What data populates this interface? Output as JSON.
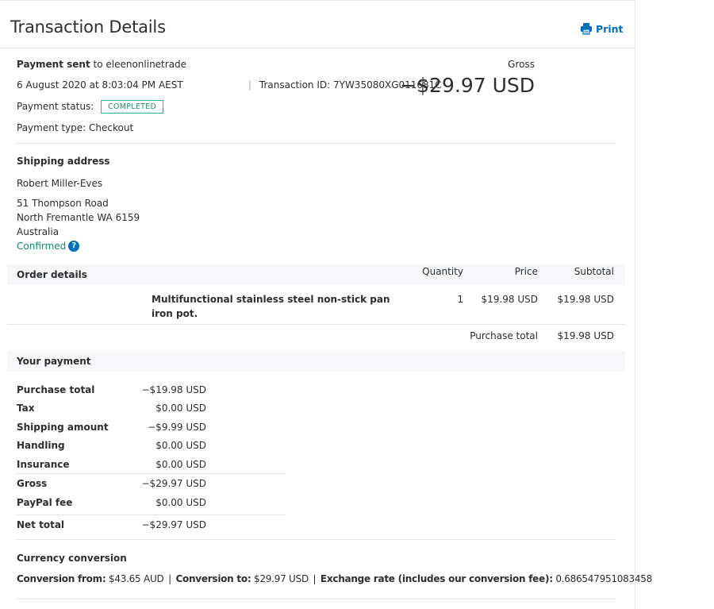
{
  "header": {
    "title": "Transaction Details",
    "print_label": "Print"
  },
  "summary": {
    "payment_sent_label": "Payment sent",
    "payment_sent_to": " to eleenonlinetrade",
    "date": "6 August 2020 at 8:03:04 PM AEST",
    "transaction_id": "Transaction ID: 7YW35080XG011681C",
    "status_label": "Payment status:",
    "status_value": "COMPLETED",
    "payment_type": "Payment type: Checkout",
    "gross_label": "Gross",
    "gross_amount": "−$29.97 USD"
  },
  "shipping": {
    "heading": "Shipping address",
    "name": "Robert Miller-Eves",
    "line1": "51 Thompson Road",
    "line2": "North Fremantle WA 6159",
    "line3": "Australia",
    "confirmed": "Confirmed",
    "help_icon": "?"
  },
  "order": {
    "heading": "Order details",
    "col_quantity": "Quantity",
    "col_price": "Price",
    "col_subtotal": "Subtotal",
    "item_name_line1": "Multifunctional stainless steel non-stick pan",
    "item_name_line2": "iron pot.",
    "item_quantity": "1",
    "item_price": "$19.98 USD",
    "item_subtotal": "$19.98 USD",
    "purchase_total_label": "Purchase total",
    "purchase_total_value": "$19.98 USD"
  },
  "payment": {
    "heading": "Your payment",
    "rows": [
      {
        "label": "Purchase total",
        "value": "−$19.98 USD"
      },
      {
        "label": "Tax",
        "value": "$0.00 USD"
      },
      {
        "label": "Shipping amount",
        "value": "−$9.99 USD"
      },
      {
        "label": "Handling",
        "value": "$0.00 USD"
      },
      {
        "label": "Insurance",
        "value": "$0.00 USD"
      },
      {
        "label": "Gross",
        "value": "−$29.97 USD"
      },
      {
        "label": "PayPal fee",
        "value": "$0.00 USD"
      },
      {
        "label": "Net total",
        "value": "−$29.97 USD"
      }
    ]
  },
  "conversion": {
    "heading": "Currency conversion",
    "from_label": "Conversion from:",
    "from_value": " $43.65 AUD",
    "to_label": "Conversion to:",
    "to_value": " $29.97 USD",
    "rate_label": "Exchange rate (includes our conversion fee):",
    "rate_value": " 0.686547951083458",
    "separator": "|"
  },
  "colors": {
    "accent": "#0070ba",
    "status_green": "#34b38a",
    "band_bg": "#f5f7fa"
  },
  "icons": {
    "print": "printer-icon",
    "help": "question-circle-icon"
  }
}
